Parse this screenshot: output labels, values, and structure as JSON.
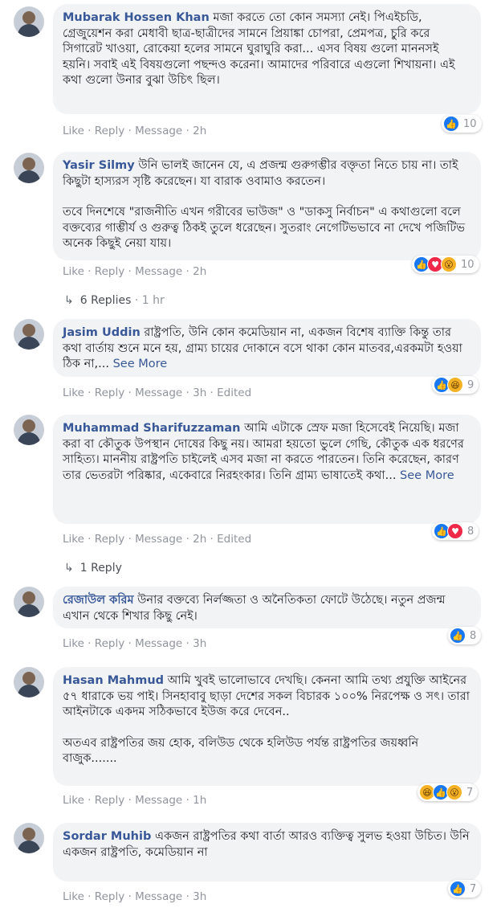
{
  "comments": [
    {
      "author": "Mubarak Hossen Khan",
      "paragraphs": [
        "মজা করতে তো কোন সমস্যা নেই। পিএইচডি, গ্রেজুয়েশন করা মেধাবী ছাত্র-ছাত্রীদের সামনে প্রিয়াঙ্কা চোপরা, প্রেমপত্র, চুরি করে সিগারেট খাওয়া, রোকেয়া হলের সামনে ঘুরাঘুরি করা... এসব বিষয় গুলো মাননসই হয়নি। সবাই এই বিষয়গুলো পছন্দও করেনা। আমাদের পরিবারে এগুলো শিখায়না। এই কথা গুলো উনার বুঝা উচিৎ ছিল।"
      ],
      "see_more": "",
      "actions": {
        "like": "Like",
        "reply": "Reply",
        "message": "Message",
        "time": "2h",
        "extra": ""
      },
      "reaction_count": "10",
      "reaction_icons": [
        "like"
      ]
    },
    {
      "author": "Yasir Silmy",
      "paragraphs": [
        "উনি ভালই জানেন যে, এ প্রজন্ম গুরুগম্ভীর বক্তৃতা নিতে চায় না। তাই কিছুটা হাস্যরস সৃষ্টি করেছেন। যা বারাক ওবামাও করতেন।",
        "তবে দিনশেষে \"রাজনীতি এখন গরীবের ভাউজ\" ও \"ডাকসু নির্বাচন\" এ কথাগুলো বলে বক্তব্যের গাম্ভীর্য ও গুরুত্ব ঠিকই তুলে ধরেছেন। সুতরাং নেগেটিভভাবে না দেখে পজিটিভ অনেক কিছুই নেয়া যায়।"
      ],
      "see_more": "",
      "actions": {
        "like": "Like",
        "reply": "Reply",
        "message": "Message",
        "time": "2h",
        "extra": ""
      },
      "reaction_count": "10",
      "reaction_icons": [
        "like",
        "love",
        "wow"
      ],
      "replies": {
        "label": "6 Replies",
        "time": "1 hr"
      }
    },
    {
      "author": "Jasim Uddin",
      "paragraphs": [
        "রাষ্ট্রপতি, উনি কোন কমেডিয়ান না, একজন বিশেষ ব্যাক্তি কিন্তু তার কথা বার্তায় শুনে মনে হয়, গ্রাম্য চায়ের দোকানে বসে থাকা কোন মাতবর,এরকমটা হওয়া ঠিক না,..."
      ],
      "see_more": "See More",
      "actions": {
        "like": "Like",
        "reply": "Reply",
        "message": "Message",
        "time": "3h",
        "extra": "Edited"
      },
      "reaction_count": "9",
      "reaction_icons": [
        "like",
        "haha"
      ]
    },
    {
      "author": "Muhammad Sharifuzzaman",
      "paragraphs": [
        "আমি এটাকে স্রেফ মজা হিসেবেই নিয়েছি। মজা করা বা কৌতুক উপস্থান দোষের কিছু নয়। আমরা হয়তো ভুলে গেছি, কৌতুক এক ধরণের সাহিত্য। মাননীয় রাষ্ট্রপতি চাইলেই এসব মজা না করতে পারতেন। তিনি করেছেন, কারণ তার ভেতরটা পরিষ্কার, একেবারে নিরহংকার। তিনি গ্রাম্য ভাষাতেই কথা..."
      ],
      "see_more": "See More",
      "actions": {
        "like": "Like",
        "reply": "Reply",
        "message": "Message",
        "time": "2h",
        "extra": "Edited"
      },
      "reaction_count": "8",
      "reaction_icons": [
        "like",
        "love"
      ],
      "replies": {
        "label": "1 Reply",
        "time": ""
      }
    },
    {
      "author": "রেজাউল করিম",
      "paragraphs": [
        "উনার বক্তব্যে নির্লজ্জতা ও অনৈতিকতা ফোটে উঠেছে। নতুন প্রজন্ম এখান থেকে শিখার কিছু নেই।"
      ],
      "see_more": "",
      "actions": {
        "like": "Like",
        "reply": "Reply",
        "message": "Message",
        "time": "3h",
        "extra": ""
      },
      "reaction_count": "8",
      "reaction_icons": [
        "like"
      ]
    },
    {
      "author": "Hasan Mahmud",
      "paragraphs": [
        "আমি খুবই ভালোভাবে দেখছি। কেননা আমি তথ্য প্রযুক্তি আইনের ৫৭ ধারাকে ভয় পাই। সিনহাবাবু ছাড়া দেশের সকল বিচারক ১০০% নিরপেক্ষ ও সৎ। তারা আইনটাকে একদম সঠিকভাবে ইউজ করে দেবেন..",
        "অতএব রাষ্ট্রপতির জয় হোক, বলিউড থেকে হলিউড পর্যন্ত রাষ্ট্রপতির জয়ধ্বনি বাজুক......."
      ],
      "see_more": "",
      "actions": {
        "like": "Like",
        "reply": "Reply",
        "message": "Message",
        "time": "1h",
        "extra": ""
      },
      "reaction_count": "7",
      "reaction_icons": [
        "haha",
        "like",
        "wow"
      ]
    },
    {
      "author": "Sordar Muhib",
      "paragraphs": [
        "একজন রাষ্ট্রপতির কথা বার্তা আরও ব্যক্তিত্ব সুলভ হওয়া উচিত। উনি একজন রাষ্ট্রপতি, কমেডিয়ান না"
      ],
      "see_more": "",
      "actions": {
        "like": "Like",
        "reply": "Reply",
        "message": "Message",
        "time": "3h",
        "extra": ""
      },
      "reaction_count": "7",
      "reaction_icons": [
        "like"
      ]
    }
  ],
  "icons": {
    "like": "👍",
    "love": "♥",
    "haha": "😆",
    "wow": "😮",
    "reply_arrow": "↳"
  },
  "colors": {
    "author": "#385898",
    "bubble": "#f2f3f5",
    "meta": "#90949c"
  }
}
